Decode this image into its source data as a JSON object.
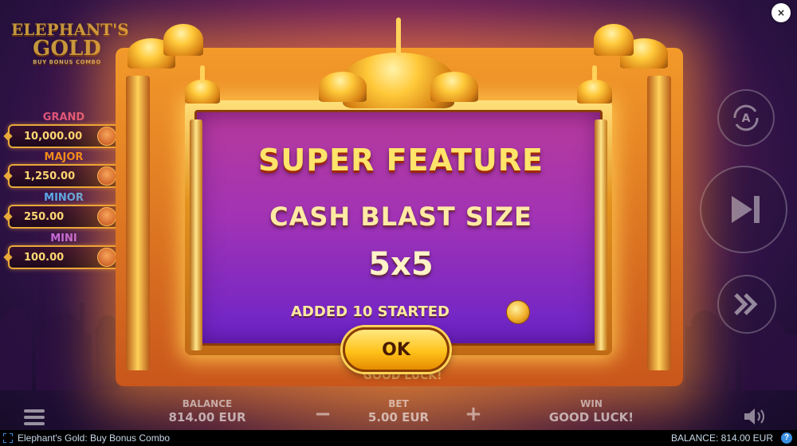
{
  "logo": {
    "line1": "ELEPHANT'S",
    "line2": "GOLD",
    "sub": "BUY BONUS COMBO"
  },
  "jackpots": [
    {
      "label": "GRAND",
      "value": "10,000.00",
      "color": "#e0567a"
    },
    {
      "label": "MAJOR",
      "value": "1,250.00",
      "color": "#f08a1c"
    },
    {
      "label": "MINOR",
      "value": "250.00",
      "color": "#58a8e8"
    },
    {
      "label": "MINI",
      "value": "100.00",
      "color": "#c56ad8"
    }
  ],
  "dialog": {
    "title": "SUPER FEATURE",
    "subtitle": "CASH BLAST SIZE",
    "size": "5x5",
    "added_text": "ADDED 10 STARTED",
    "ok_label": "OK"
  },
  "behind_text": "GOOD LUCK!",
  "bottom": {
    "balance_label": "BALANCE",
    "balance_value": "814.00 EUR",
    "bet_label": "BET",
    "bet_value": "5.00 EUR",
    "win_label": "WIN",
    "win_value": "GOOD LUCK!",
    "minus": "−",
    "plus": "+"
  },
  "status_bar": {
    "title": "Elephant's Gold: Buy Bonus Combo",
    "balance": "BALANCE: 814.00 EUR",
    "help": "?"
  },
  "close_label": "×",
  "icons": [
    "close-icon",
    "autoplay-icon",
    "skip-icon",
    "turbo-icon",
    "menu-icon",
    "sound-icon",
    "coin-icon",
    "fullscreen-icon",
    "help-icon"
  ]
}
